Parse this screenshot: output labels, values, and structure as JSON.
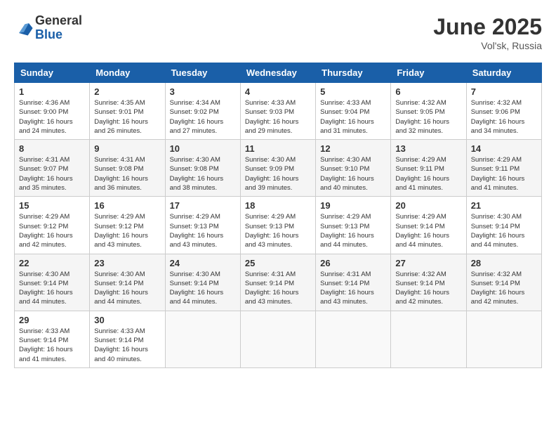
{
  "header": {
    "logo_general": "General",
    "logo_blue": "Blue",
    "month_title": "June 2025",
    "location": "Vol'sk, Russia"
  },
  "days_of_week": [
    "Sunday",
    "Monday",
    "Tuesday",
    "Wednesday",
    "Thursday",
    "Friday",
    "Saturday"
  ],
  "weeks": [
    [
      {
        "day": "1",
        "sunrise": "4:36 AM",
        "sunset": "9:00 PM",
        "daylight": "16 hours and 24 minutes."
      },
      {
        "day": "2",
        "sunrise": "4:35 AM",
        "sunset": "9:01 PM",
        "daylight": "16 hours and 26 minutes."
      },
      {
        "day": "3",
        "sunrise": "4:34 AM",
        "sunset": "9:02 PM",
        "daylight": "16 hours and 27 minutes."
      },
      {
        "day": "4",
        "sunrise": "4:33 AM",
        "sunset": "9:03 PM",
        "daylight": "16 hours and 29 minutes."
      },
      {
        "day": "5",
        "sunrise": "4:33 AM",
        "sunset": "9:04 PM",
        "daylight": "16 hours and 31 minutes."
      },
      {
        "day": "6",
        "sunrise": "4:32 AM",
        "sunset": "9:05 PM",
        "daylight": "16 hours and 32 minutes."
      },
      {
        "day": "7",
        "sunrise": "4:32 AM",
        "sunset": "9:06 PM",
        "daylight": "16 hours and 34 minutes."
      }
    ],
    [
      {
        "day": "8",
        "sunrise": "4:31 AM",
        "sunset": "9:07 PM",
        "daylight": "16 hours and 35 minutes."
      },
      {
        "day": "9",
        "sunrise": "4:31 AM",
        "sunset": "9:08 PM",
        "daylight": "16 hours and 36 minutes."
      },
      {
        "day": "10",
        "sunrise": "4:30 AM",
        "sunset": "9:08 PM",
        "daylight": "16 hours and 38 minutes."
      },
      {
        "day": "11",
        "sunrise": "4:30 AM",
        "sunset": "9:09 PM",
        "daylight": "16 hours and 39 minutes."
      },
      {
        "day": "12",
        "sunrise": "4:30 AM",
        "sunset": "9:10 PM",
        "daylight": "16 hours and 40 minutes."
      },
      {
        "day": "13",
        "sunrise": "4:29 AM",
        "sunset": "9:11 PM",
        "daylight": "16 hours and 41 minutes."
      },
      {
        "day": "14",
        "sunrise": "4:29 AM",
        "sunset": "9:11 PM",
        "daylight": "16 hours and 41 minutes."
      }
    ],
    [
      {
        "day": "15",
        "sunrise": "4:29 AM",
        "sunset": "9:12 PM",
        "daylight": "16 hours and 42 minutes."
      },
      {
        "day": "16",
        "sunrise": "4:29 AM",
        "sunset": "9:12 PM",
        "daylight": "16 hours and 43 minutes."
      },
      {
        "day": "17",
        "sunrise": "4:29 AM",
        "sunset": "9:13 PM",
        "daylight": "16 hours and 43 minutes."
      },
      {
        "day": "18",
        "sunrise": "4:29 AM",
        "sunset": "9:13 PM",
        "daylight": "16 hours and 43 minutes."
      },
      {
        "day": "19",
        "sunrise": "4:29 AM",
        "sunset": "9:13 PM",
        "daylight": "16 hours and 44 minutes."
      },
      {
        "day": "20",
        "sunrise": "4:29 AM",
        "sunset": "9:14 PM",
        "daylight": "16 hours and 44 minutes."
      },
      {
        "day": "21",
        "sunrise": "4:30 AM",
        "sunset": "9:14 PM",
        "daylight": "16 hours and 44 minutes."
      }
    ],
    [
      {
        "day": "22",
        "sunrise": "4:30 AM",
        "sunset": "9:14 PM",
        "daylight": "16 hours and 44 minutes."
      },
      {
        "day": "23",
        "sunrise": "4:30 AM",
        "sunset": "9:14 PM",
        "daylight": "16 hours and 44 minutes."
      },
      {
        "day": "24",
        "sunrise": "4:30 AM",
        "sunset": "9:14 PM",
        "daylight": "16 hours and 44 minutes."
      },
      {
        "day": "25",
        "sunrise": "4:31 AM",
        "sunset": "9:14 PM",
        "daylight": "16 hours and 43 minutes."
      },
      {
        "day": "26",
        "sunrise": "4:31 AM",
        "sunset": "9:14 PM",
        "daylight": "16 hours and 43 minutes."
      },
      {
        "day": "27",
        "sunrise": "4:32 AM",
        "sunset": "9:14 PM",
        "daylight": "16 hours and 42 minutes."
      },
      {
        "day": "28",
        "sunrise": "4:32 AM",
        "sunset": "9:14 PM",
        "daylight": "16 hours and 42 minutes."
      }
    ],
    [
      {
        "day": "29",
        "sunrise": "4:33 AM",
        "sunset": "9:14 PM",
        "daylight": "16 hours and 41 minutes."
      },
      {
        "day": "30",
        "sunrise": "4:33 AM",
        "sunset": "9:14 PM",
        "daylight": "16 hours and 40 minutes."
      },
      null,
      null,
      null,
      null,
      null
    ]
  ]
}
